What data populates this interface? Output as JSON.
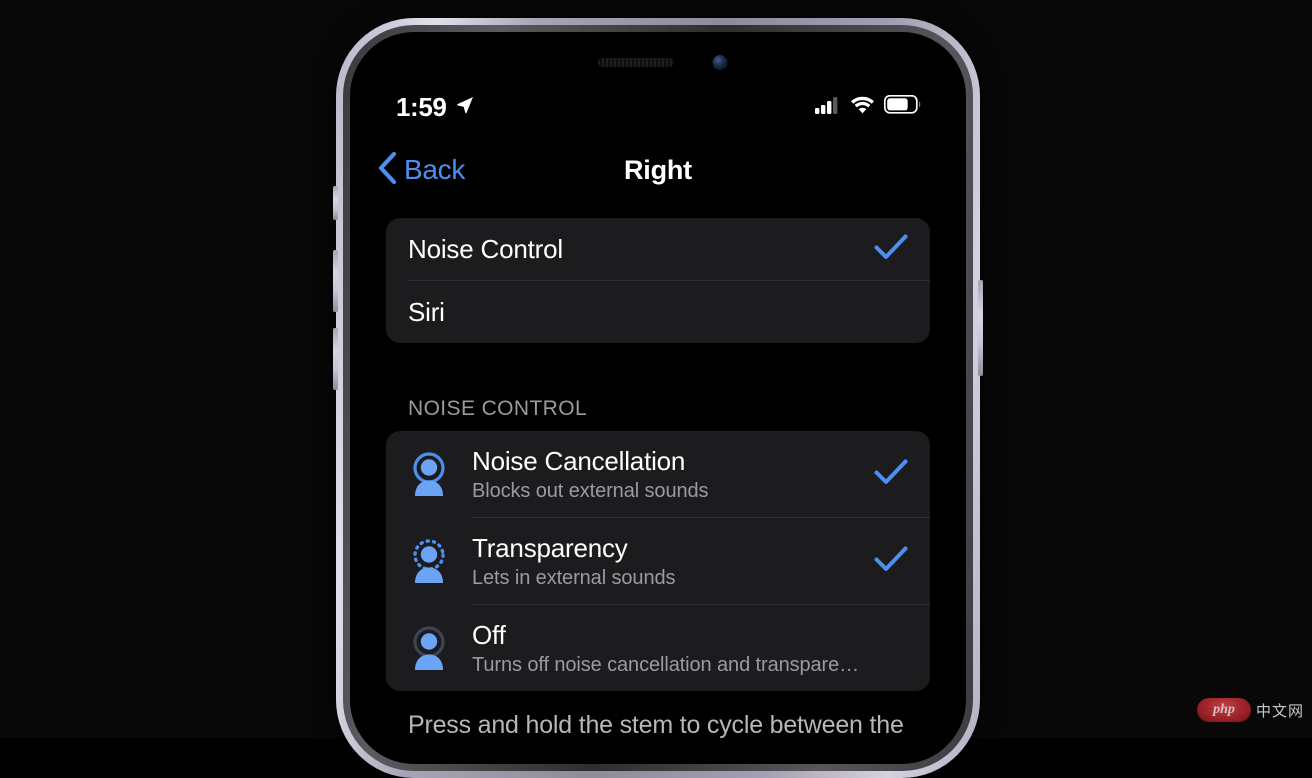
{
  "status_bar": {
    "time": "1:59",
    "location_icon": "location-arrow-icon",
    "cellular_icon": "cellular-signal-icon",
    "wifi_icon": "wifi-icon",
    "battery_icon": "battery-icon",
    "battery_level_percent": 66,
    "signal_bars_filled": 3,
    "signal_bars_total": 4
  },
  "nav": {
    "back_label": "Back",
    "back_icon": "chevron-left-icon",
    "title": "Right"
  },
  "press_and_hold_group": {
    "items": [
      {
        "label": "Noise Control",
        "checked": true
      },
      {
        "label": "Siri",
        "checked": false
      }
    ]
  },
  "noise_control_section": {
    "header": "NOISE CONTROL",
    "items": [
      {
        "icon": "person-noise-cancellation-icon",
        "title": "Noise Cancellation",
        "subtitle": "Blocks out external sounds",
        "checked": true
      },
      {
        "icon": "person-transparency-icon",
        "title": "Transparency",
        "subtitle": "Lets in external sounds",
        "checked": true
      },
      {
        "icon": "person-off-icon",
        "title": "Off",
        "subtitle": "Turns off noise cancellation and transpare…",
        "checked": false
      }
    ],
    "footer": "Press and hold the stem to cycle between the"
  },
  "colors": {
    "accent_blue": "#4b8ff0",
    "checkmark_blue": "#4b8ff0",
    "group_background": "#1c1c1e",
    "screen_background": "#000000",
    "secondary_text": "#9b9b9f",
    "separator": "#2f2f32"
  },
  "watermark": {
    "logo_text": "php",
    "suffix_text": "中文网"
  }
}
